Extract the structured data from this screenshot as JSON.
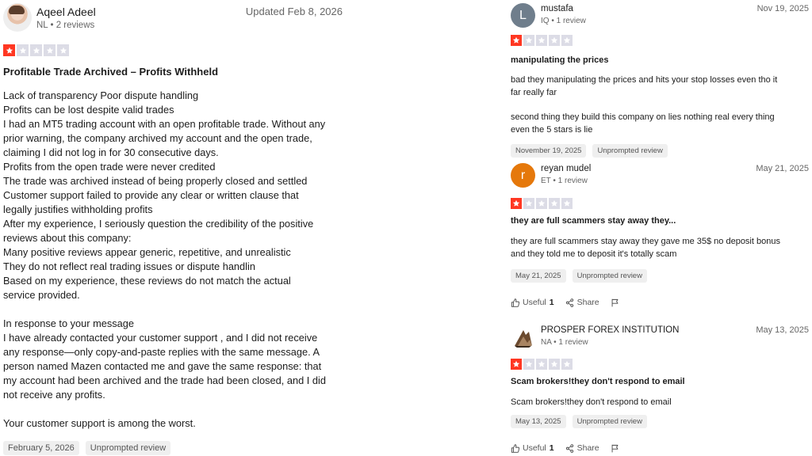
{
  "review_main": {
    "name": "Aqeel Adeel",
    "meta": "NL • 2 reviews",
    "date": "Updated Feb 8, 2026",
    "rating": 1,
    "title": "Profitable Trade Archived – Profits Withheld",
    "body": [
      "Lack of transparency Poor dispute handling",
      "Profits can be lost despite valid trades",
      "I had an MT5 trading account with an open profitable trade. Without any",
      "prior warning, the company archived my account and the open trade,",
      "claiming I did not log in for 30 consecutive days.",
      "Profits from the open trade were never credited",
      "The trade was archived instead of being properly closed and settled",
      "Customer support failed to provide any clear or written clause that",
      "legally justifies withholding profits",
      "After my experience, I seriously question the credibility of the positive",
      "reviews about this company:",
      "Many positive reviews appear generic, repetitive, and unrealistic",
      "They do not reflect real trading issues or dispute handlin",
      "Based on my experience, these reviews do not match the actual",
      "service provided.",
      "",
      "In response to your message",
      "I have already contacted your customer support , and I did not receive",
      "any response—only copy-and-paste replies with the same message. A",
      "person named Mazen contacted me and gave the same response: that",
      "my account had been archived and the trade had been closed, and I did",
      "not receive any profits.",
      "",
      "Your customer support is among the worst."
    ],
    "experience_date": "February 5, 2026",
    "tag": "Unprompted review"
  },
  "review_1": {
    "avatar_letter": "L",
    "name": "mustafa",
    "meta": "IQ • 1 review",
    "date": "Nov 19, 2025",
    "rating": 1,
    "title": "manipulating the prices",
    "body_p1": [
      "bad they manipulating the prices and hits your stop losses even tho it",
      "far really far"
    ],
    "body_p2": [
      "second thing they build this company on lies nothing real every thing",
      "even the 5 stars is lie"
    ],
    "experience_date": "November 19, 2025",
    "tag": "Unprompted review"
  },
  "review_2": {
    "avatar_letter": "r",
    "name": "reyan mudel",
    "meta": "ET • 1 review",
    "date": "May 21, 2025",
    "rating": 1,
    "title": "they are full scammers stay away they...",
    "body": [
      "they are full scammers stay away they gave me 35$ no deposit bonus",
      "and they told me to deposit it's totally scam"
    ],
    "experience_date": "May 21, 2025",
    "tag": "Unprompted review",
    "useful_label": "Useful",
    "useful_count": "1",
    "share_label": "Share"
  },
  "review_3": {
    "name": "PROSPER FOREX INSTITUTION",
    "meta": "NA • 1 review",
    "date": "May 13, 2025",
    "rating": 1,
    "title": "Scam brokers!they don't respond to email",
    "body": [
      "Scam brokers!they don't respond to email"
    ],
    "experience_date": "May 13, 2025",
    "tag": "Unprompted review",
    "useful_label": "Useful",
    "useful_count": "1",
    "share_label": "Share"
  },
  "colors": {
    "star_on": "#ff3722",
    "star_off": "#dcdce6",
    "tag_bg": "#efefef"
  },
  "icons": [
    "star-icon",
    "thumbs-up-icon",
    "share-icon",
    "flag-icon"
  ]
}
